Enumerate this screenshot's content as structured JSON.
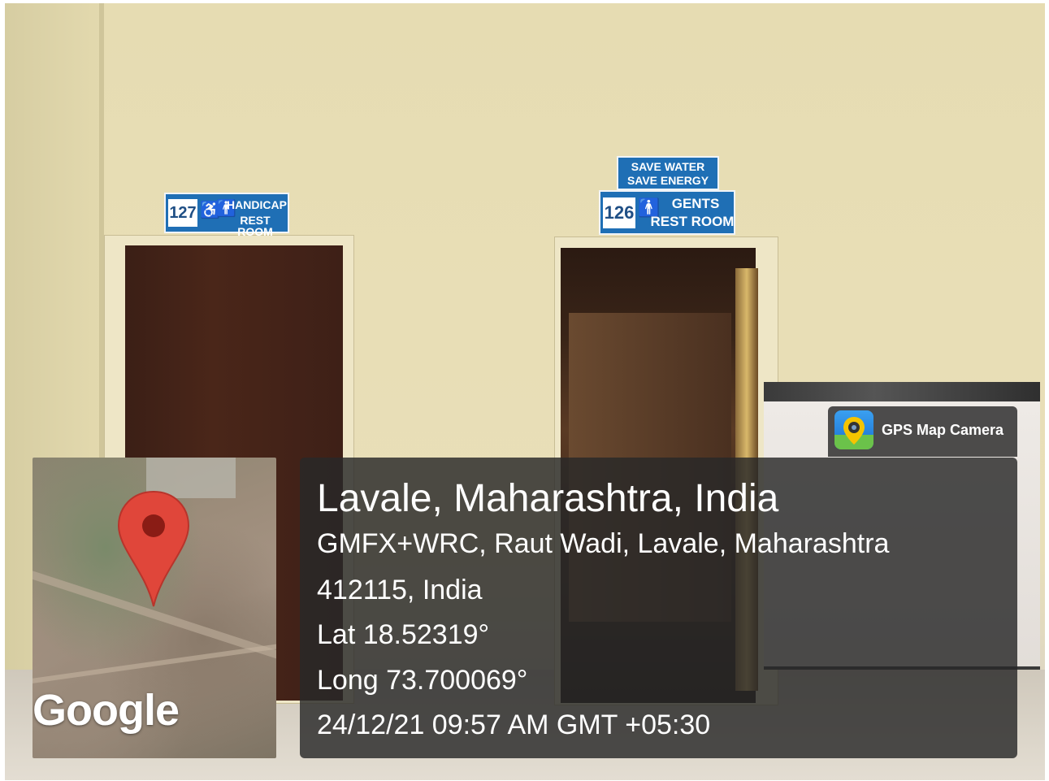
{
  "signs": {
    "handicap": {
      "number": "127",
      "line1": "HANDICAP",
      "line2": "REST ROOM"
    },
    "gents": {
      "number": "126",
      "line1": "GENTS",
      "line2": "REST ROOM"
    },
    "save": {
      "line1": "SAVE WATER",
      "line2": "SAVE ENERGY"
    }
  },
  "map": {
    "logo": "Google",
    "pin_icon": "map-pin-icon",
    "pin_color": "#e0463a"
  },
  "brand": {
    "label": "GPS Map Camera",
    "icon": "gps-map-camera-icon"
  },
  "location": {
    "title": "Lavale, Maharashtra, India",
    "address_line1": "GMFX+WRC, Raut Wadi, Lavale, Maharashtra",
    "address_line2": "412115, India",
    "lat": "Lat 18.52319°",
    "long": "Long 73.700069°",
    "datetime": "24/12/21 09:57 AM GMT +05:30"
  }
}
